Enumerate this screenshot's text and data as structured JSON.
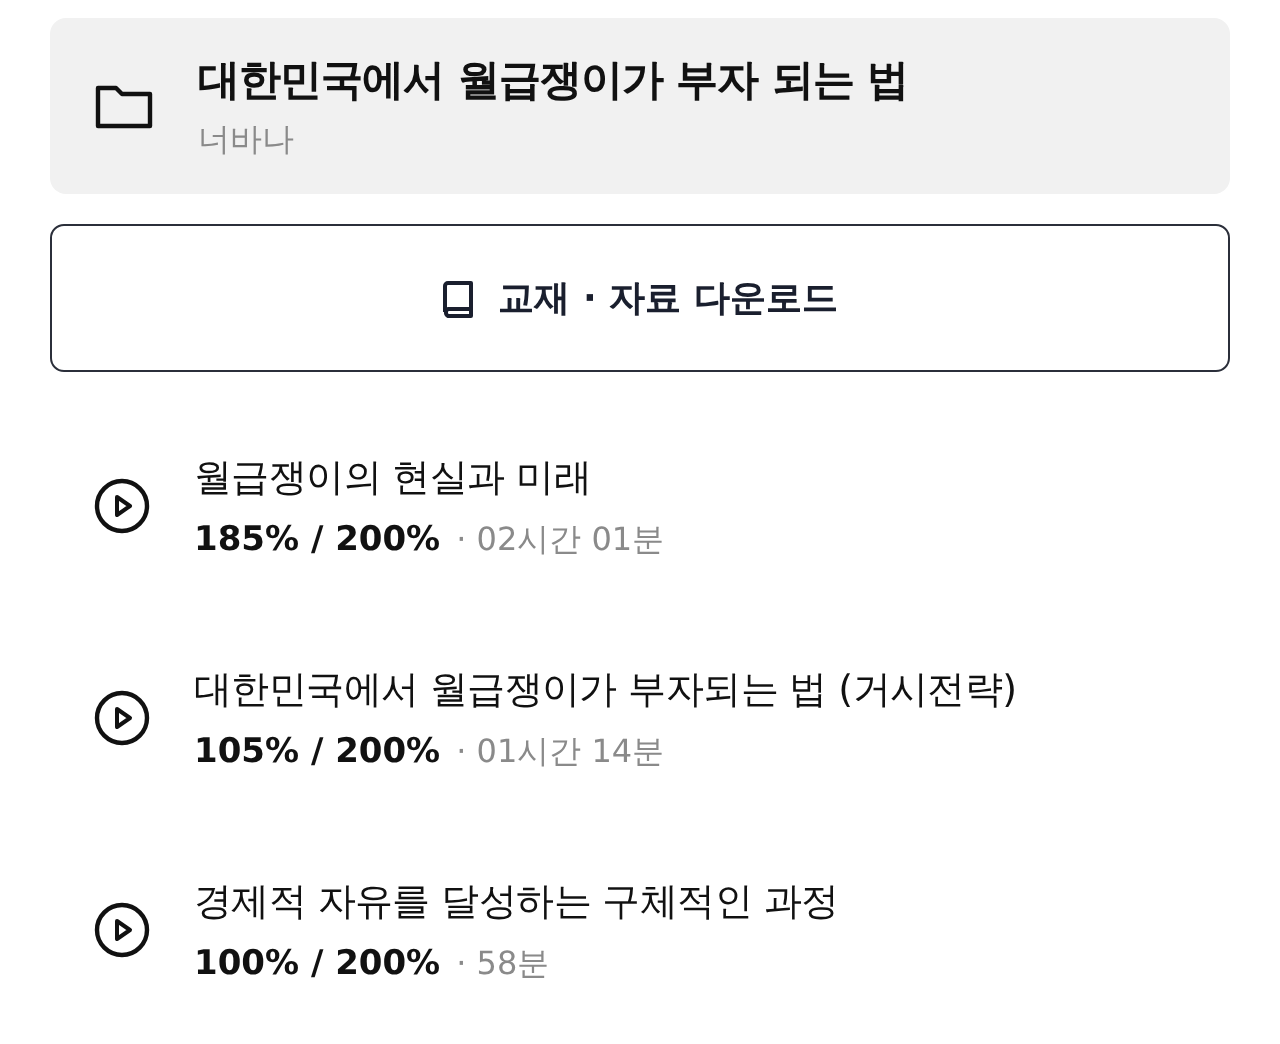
{
  "course": {
    "title": "대한민국에서 월급쟁이가 부자 되는 법",
    "author": "너바나"
  },
  "download_button": {
    "label": "교재 · 자료 다운로드"
  },
  "lessons": [
    {
      "title": "월급쟁이의 현실과 미래",
      "progress": "185% / 200%",
      "duration": "· 02시간 01분"
    },
    {
      "title": "대한민국에서 월급쟁이가 부자되는 법 (거시전략)",
      "progress": "105% / 200%",
      "duration": "· 01시간 14분"
    },
    {
      "title": "경제적 자유를 달성하는 구체적인 과정",
      "progress": "100% / 200%",
      "duration": "· 58분"
    }
  ]
}
